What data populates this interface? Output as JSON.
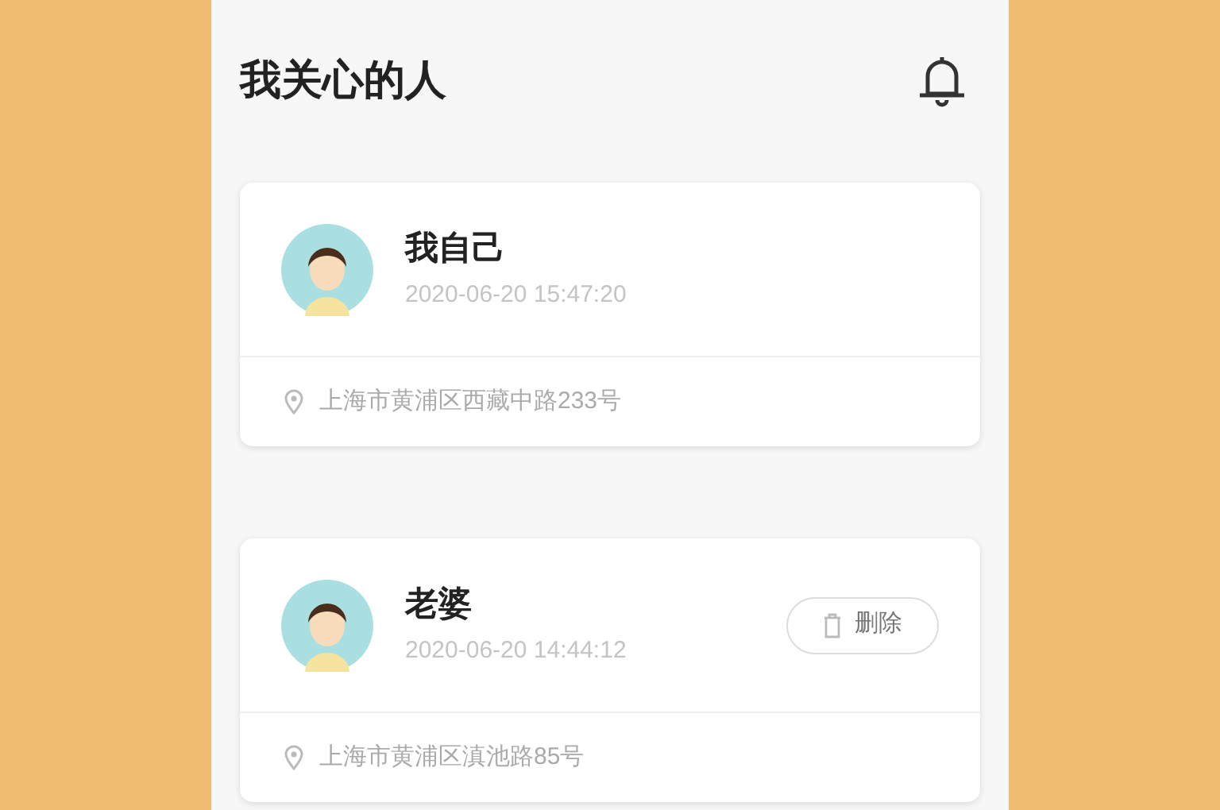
{
  "header": {
    "title": "我关心的人"
  },
  "people": [
    {
      "name": "我自己",
      "time": "2020-06-20 15:47:20",
      "address": "上海市黄浦区西藏中路233号",
      "deletable": false
    },
    {
      "name": "老婆",
      "time": "2020-06-20 14:44:12",
      "address": "上海市黄浦区滇池路85号",
      "deletable": true,
      "delete_label": "删除"
    }
  ]
}
